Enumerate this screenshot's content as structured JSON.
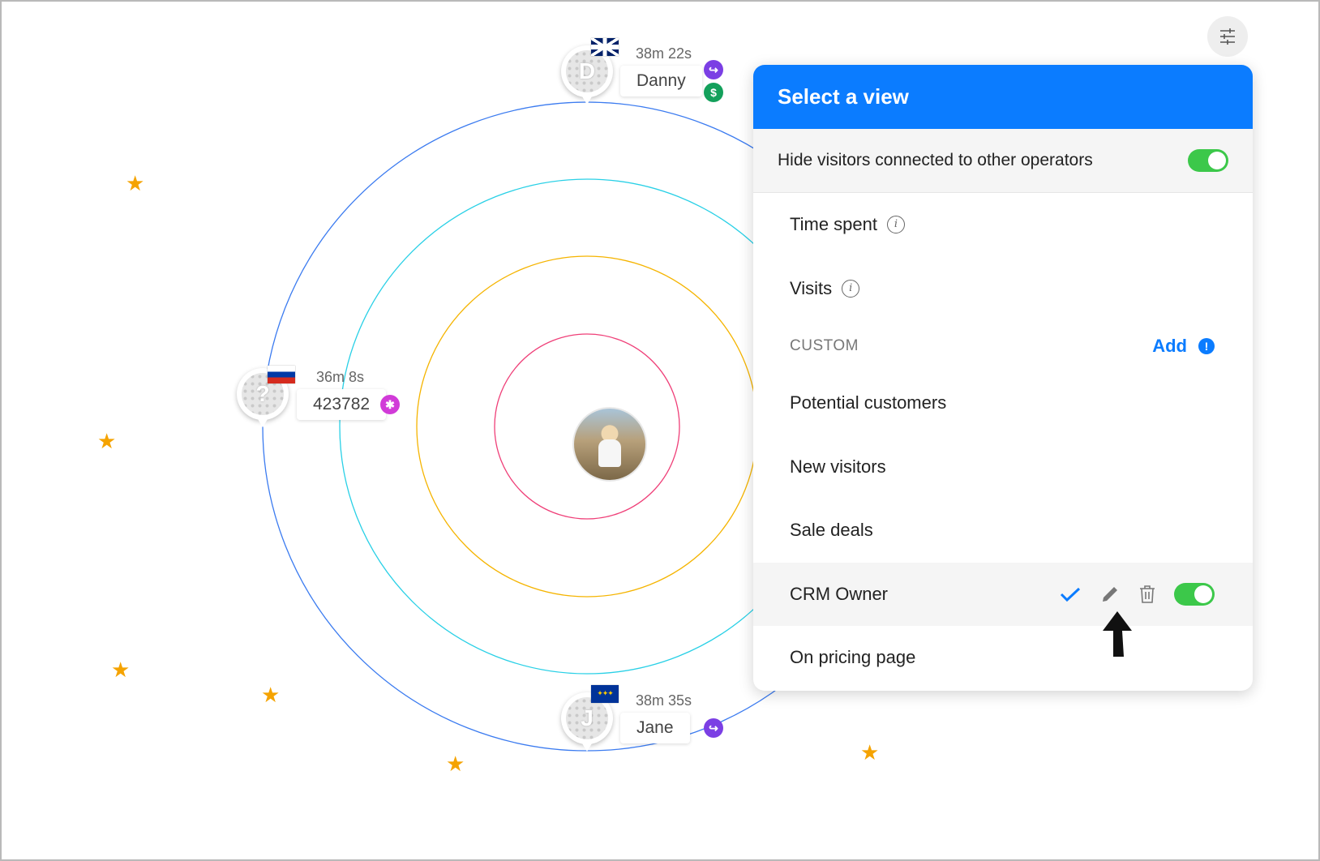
{
  "visitors": [
    {
      "id": "danny",
      "letter": "D",
      "time": "38m 22s",
      "name": "Danny",
      "flag": "uk-flag",
      "badges": [
        "redirect-icon",
        "dollar-icon"
      ]
    },
    {
      "id": "unknown",
      "letter": "?",
      "time": "36m 8s",
      "name": "423782",
      "flag": "russia-flag",
      "badges": [
        "asterisk-icon"
      ]
    },
    {
      "id": "jane",
      "letter": "J",
      "time": "38m 35s",
      "name": "Jane",
      "flag": "eu-flag",
      "badges": [
        "redirect-icon"
      ]
    }
  ],
  "badge_glyphs": {
    "redirect": "↪",
    "dollar": "$",
    "asterisk": "✱"
  },
  "colors": {
    "accent": "#0b7cff",
    "toggle_on": "#3cc84a",
    "star": "#f5a300",
    "redirect_badge": "#7b3fe4",
    "dollar_badge": "#13a05b",
    "asterisk_badge": "#d13bd8",
    "ring_outer": "#3b7bf0",
    "ring_2": "#29d0e6",
    "ring_3": "#f5b400",
    "ring_inner": "#ef3f78"
  },
  "panel": {
    "title": "Select a view",
    "hide_visitors_label": "Hide visitors connected to other operators",
    "hide_visitors_on": true,
    "items": [
      {
        "label": "Time spent",
        "info": "i"
      },
      {
        "label": "Visits",
        "info": "i"
      }
    ],
    "custom_section_label": "CUSTOM",
    "add_label": "Add",
    "add_info": "!",
    "custom_items": [
      {
        "label": "Potential customers"
      },
      {
        "label": "New visitors"
      },
      {
        "label": "Sale deals"
      },
      {
        "label": "CRM Owner",
        "selected": true,
        "enabled": true
      },
      {
        "label": "On pricing page"
      }
    ]
  }
}
